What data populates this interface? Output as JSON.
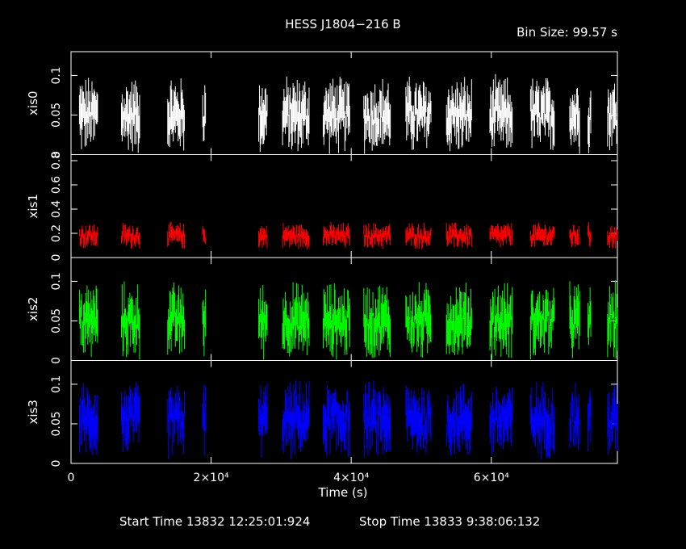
{
  "title": "HESS J1804−216 B",
  "bin_size": "Bin Size:  99.57  s",
  "footer": {
    "start": "Start Time 13832 12:25:01:924",
    "stop": "Stop Time 13833  9:38:06:132"
  },
  "chart_data": {
    "type": "line",
    "xlabel": "Time (s)",
    "xlim": [
      0,
      78000
    ],
    "x_ticks": [
      {
        "value": 0,
        "label": "0"
      },
      {
        "value": 20000,
        "label": "2×10⁴"
      },
      {
        "value": 40000,
        "label": "4×10⁴"
      },
      {
        "value": 60000,
        "label": "6×10⁴"
      }
    ],
    "segments": [
      [
        1200,
        3800
      ],
      [
        7200,
        9800
      ],
      [
        13800,
        16200
      ],
      [
        18800,
        19200
      ],
      [
        26800,
        28000
      ],
      [
        30200,
        34000
      ],
      [
        36000,
        39800
      ],
      [
        41800,
        45600
      ],
      [
        47800,
        51400
      ],
      [
        53600,
        57200
      ],
      [
        59800,
        63000
      ],
      [
        65600,
        69000
      ],
      [
        71200,
        72600
      ],
      [
        73800,
        74200
      ],
      [
        76600,
        78000
      ]
    ],
    "panels": [
      {
        "name": "xis0",
        "color": "#ffffff",
        "ylim": [
          0,
          0.13
        ],
        "mean": 0.05,
        "spread": 0.022,
        "ticks": [
          {
            "value": 0.1,
            "label": "0.1"
          },
          {
            "value": 0.05,
            "label": "0.05"
          },
          {
            "value": 0,
            "label": "0"
          }
        ]
      },
      {
        "name": "xis1",
        "color": "#ff0000",
        "ylim": [
          0,
          0.85
        ],
        "mean": 0.18,
        "spread": 0.05,
        "ticks": [
          {
            "value": 0.8,
            "label": "0.8"
          },
          {
            "value": 0.6,
            "label": "0.6"
          },
          {
            "value": 0.4,
            "label": "0.4"
          },
          {
            "value": 0.2,
            "label": "0.2"
          },
          {
            "value": 0,
            "label": "0"
          }
        ]
      },
      {
        "name": "xis2",
        "color": "#00ff00",
        "ylim": [
          0,
          0.13
        ],
        "mean": 0.05,
        "spread": 0.022,
        "ticks": [
          {
            "value": 0.1,
            "label": "0.1"
          },
          {
            "value": 0.05,
            "label": "0.05"
          },
          {
            "value": 0,
            "label": "0"
          }
        ]
      },
      {
        "name": "xis3",
        "color": "#0000ff",
        "ylim": [
          0,
          0.13
        ],
        "mean": 0.055,
        "spread": 0.022,
        "ticks": [
          {
            "value": 0.1,
            "label": "0.1"
          },
          {
            "value": 0.05,
            "label": "0.05"
          },
          {
            "value": 0,
            "label": "0"
          }
        ]
      }
    ]
  }
}
